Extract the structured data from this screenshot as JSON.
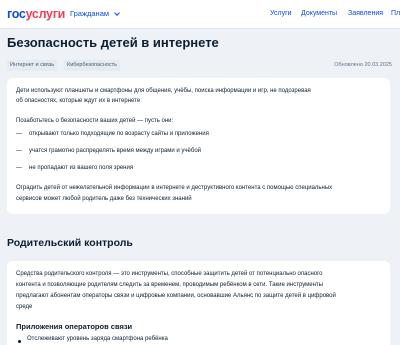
{
  "header": {
    "logo_part1": "гос",
    "logo_part2": "услуги",
    "audience": "Гражданам",
    "nav": [
      "Услуги",
      "Документы",
      "Заявления",
      "Пл"
    ]
  },
  "page": {
    "title": "Безопасность детей в интернете",
    "tags": [
      "Интернет и связь",
      "Кибербезопасность"
    ],
    "updated": "Обновлено 20.03.2025"
  },
  "intro": {
    "lines": [
      "Дети используют планшеты и смартфоны для общения, учёбы, поиска информации и игр, не подозревая",
      "об опасностях, которые ждут их в интернете"
    ],
    "list_title": "Позаботьтесь о безопасности ваших детей — пусть они:",
    "items": [
      "открывают только подходящие по возрасту сайты и приложения",
      "учатся грамотно распределять время между играми и учёбой",
      "не пропадают из вашего поля зрения"
    ],
    "outro_lines": [
      "Оградить детей от нежелательной информации в интернете и деструктивного контента с помощью специальных",
      "сервисов может любой родитель даже без технических знаний"
    ],
    "dash": "—"
  },
  "parental": {
    "title": "Родительский контроль",
    "lines": [
      "Средства родительского контроля — это инструменты, способные защитить детей от потенциально опасного",
      "контента и позволяющие родителям следить за временем, проводимым ребёнком в сети. Такие инструменты",
      "предлагают абонентам операторы связи и цифровые компании, основавшие Альянс по защите детей в цифровой",
      "среде"
    ],
    "subhead": "Приложения операторов связи",
    "bullets": [
      "Отслеживают уровень заряда смартфона ребёнка"
    ]
  },
  "colors": {
    "brand_blue": "#0d4cd3",
    "brand_red": "#ee3f58",
    "page_bg": "#eef2f7"
  }
}
